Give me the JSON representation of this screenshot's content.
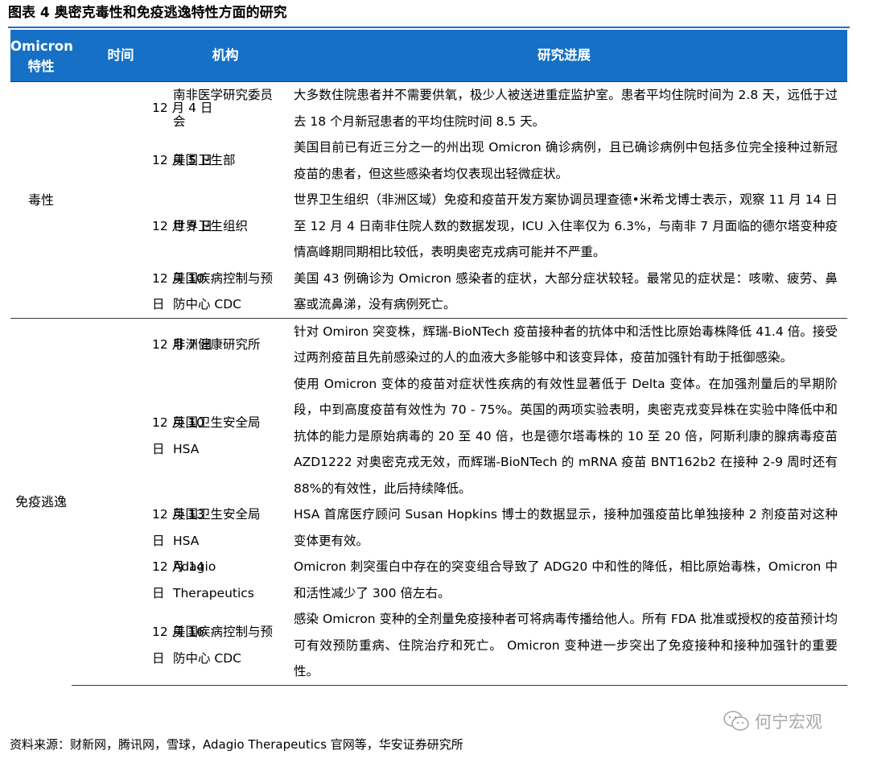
{
  "figure_title": "图表 4 奥密克毒性和免疫逃逸特性方面的研究",
  "table": {
    "headers": {
      "trait": "Omicron 特性",
      "time": "时间",
      "org": "机构",
      "progress": "研究进展"
    },
    "sections": [
      {
        "trait": "毒性",
        "rows": [
          {
            "date": [
              "12 月 4 日"
            ],
            "org": "南非医学研究委员会",
            "progress": "大多数住院患者并不需要供氧，极少人被送进重症监护室。患者平均住院时间为 2.8 天，远低于过去 18 个月新冠患者的平均住院时间 8.5 天。"
          },
          {
            "date": [
              "12 月 5 日"
            ],
            "org": "美国卫生部",
            "progress": "美国目前已有近三分之一的州出现 Omicron 确诊病例，且已确诊病例中包括多位完全接种过新冠疫苗的患者，但这些感染者均仅表现出轻微症状。"
          },
          {
            "date": [
              "12 月 9 日"
            ],
            "org": "世界卫生组织",
            "progress": "世界卫生组织（非洲区域）免疫和疫苗开发方案协调员理查德•米希戈博士表示，观察 11 月 14 日至 12 月 4 日南非住院人数的数据发现，ICU 入住率仅为 6.3%，与南非 7 月面临的德尔塔变种疫情高峰期同期相比较低，表明奥密克戎病可能并不严重。"
          },
          {
            "date": [
              "12 月 10",
              "日"
            ],
            "org": "美国疾病控制与预防中心 CDC",
            "progress": "美国 43 例确诊为 Omicron 感染者的症状，大部分症状较轻。最常见的症状是：咳嗽、疲劳、鼻塞或流鼻涕，没有病例死亡。"
          }
        ]
      },
      {
        "trait": "免疫逃逸",
        "rows": [
          {
            "date": [
              "12 月 7 日"
            ],
            "org": "非洲健康研究所",
            "progress": "针对 Omiron 突变株，辉瑞-BioNTech 疫苗接种者的抗体中和活性比原始毒株降低 41.4 倍。接受过两剂疫苗且先前感染过的人的血液大多能够中和该变异体，疫苗加强针有助于抵御感染。"
          },
          {
            "date": [
              "12 月 10",
              "日"
            ],
            "org": "英国卫生安全局 HSA",
            "progress": "使用 Omicron 变体的疫苗对症状性疾病的有效性显著低于 Delta 变体。在加强剂量后的早期阶段，中到高度疫苗有效性为 70 - 75%。英国的两项实验表明，奥密克戎变异株在实验中降低中和抗体的能力是原始病毒的 20 至 40 倍，也是德尔塔毒株的 10 至 20 倍，阿斯利康的腺病毒疫苗 AZD1222 对奥密克戎无效，而辉瑞-BioNTech 的 mRNA 疫苗 BNT162b2 在接种 2-9 周时还有 88%的有效性，此后持续降低。"
          },
          {
            "date": [
              "12 月 13",
              "日"
            ],
            "org": "英国卫生安全局 HSA",
            "progress": "HSA 首席医疗顾问 Susan Hopkins 博士的数据显示，接种加强疫苗比单独接种 2 剂疫苗对这种变体更有效。"
          },
          {
            "date": [
              "12 月 14",
              "日"
            ],
            "org": "Adagio Therapeutics",
            "progress": "Omicron 刺突蛋白中存在的突变组合导致了 ADG20 中和性的降低，相比原始毒株，Omicron 中和活性减少了 300 倍左右。"
          },
          {
            "date": [
              "12 月 16",
              "日"
            ],
            "org": "美国疾病控制与预防中心 CDC",
            "progress": "感染 Omicron 变种的全剂量免疫接种者可将病毒传播给他人。所有 FDA 批准或授权的疫苗预计均可有效预防重病、住院治疗和死亡。 Omicron 变种进一步突出了免疫接种和接种加强针的重要性。"
          }
        ]
      }
    ]
  },
  "source_note": "资料来源：财新网，腾讯网，雪球，Adagio Therapeutics 官网等，华安证券研究所",
  "watermark": {
    "text": "何宁宏观",
    "icon": "wechat-icon"
  },
  "colors": {
    "header_bg": "#1570c6",
    "header_text": "#ffffff",
    "rule": "#1a73c4"
  }
}
